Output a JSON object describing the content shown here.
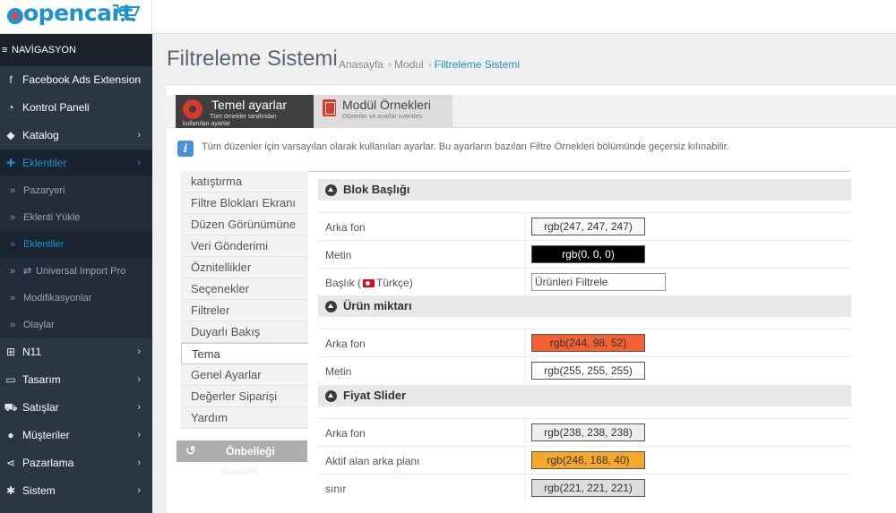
{
  "header": {
    "logo_text": "opencart"
  },
  "sidebar": {
    "nav_title": "NAVİGASYON",
    "items": [
      {
        "label": "Facebook Ads Extension",
        "icon": "facebook-icon",
        "chevron": true
      },
      {
        "label": "Kontrol Paneli",
        "icon": "dashboard-icon",
        "chevron": false
      },
      {
        "label": "Katalog",
        "icon": "tag-icon",
        "chevron": true
      },
      {
        "label": "Eklentiler",
        "icon": "puzzle-icon",
        "chevron": true,
        "active": true
      }
    ],
    "subitems": [
      {
        "label": "Pazaryeri"
      },
      {
        "label": "Eklenti Yükle"
      },
      {
        "label": "Eklentiler",
        "active": true
      },
      {
        "label": "Universal Import Pro",
        "icon": "sync-icon"
      },
      {
        "label": "Modifikasyonlar"
      },
      {
        "label": "Olaylar"
      }
    ],
    "items2": [
      {
        "label": "N11",
        "icon": "sitemap-icon"
      },
      {
        "label": "Tasarım",
        "icon": "monitor-icon"
      },
      {
        "label": "Satışlar",
        "icon": "cart-icon"
      },
      {
        "label": "Müşteriler",
        "icon": "user-icon"
      },
      {
        "label": "Pazarlama",
        "icon": "share-icon"
      },
      {
        "label": "Sistem",
        "icon": "cog-icon"
      }
    ]
  },
  "page": {
    "title": "Filtreleme Sistemi",
    "breadcrumb": [
      "Anasayfa",
      "Modul",
      "Filtreleme Sistemi"
    ]
  },
  "tabs": {
    "tab1_title": "Temel ayarlar",
    "tab1_sub": "Tüm örnekler tarafından",
    "tab1_sub2": "kullanılan ayarlar",
    "tab2_title": "Modül Örnekleri",
    "tab2_sub": "Düzenler ve ayarlar overides"
  },
  "info": {
    "text": "Tüm düzenler için varsayılan olarak kullanılan ayarlar. Bu ayarların bazıları Filtre Örnekleri bölümünde geçersiz kılınabilir."
  },
  "left_menu": [
    "katıştırma",
    "Filtre Blokları Ekranı",
    "Düzen Görünümüne",
    "Veri Gönderimi",
    "Öznitellikler",
    "Seçenekler",
    "Filtreler",
    "Duyarlı Bakış",
    "Tema",
    "Genel Ayarlar",
    "Değerler Siparişi",
    "Yardım"
  ],
  "cache": {
    "label": "Önbelleği",
    "sub": "Güncelle"
  },
  "sections": {
    "s1": {
      "title": "Blok Başlığı",
      "r1_label": "Arka fon",
      "r1_value": "rgb(247, 247, 247)",
      "r1_bg": "#f7f7f7",
      "r1_fg": "#333333",
      "r2_label": "Metin",
      "r2_value": "rgb(0, 0, 0)",
      "r2_bg": "#000000",
      "r2_fg": "#ffffff",
      "r3_label_a": "Başlık (",
      "r3_label_b": "Türkçe)",
      "r3_value": "Ürünleri Filtrele"
    },
    "s2": {
      "title": "Ürün miktarı",
      "r1_label": "Arka fon",
      "r1_value": "rgb(244, 98, 52)",
      "r1_bg": "#f46234",
      "r1_fg": "#333333",
      "r2_label": "Metin",
      "r2_value": "rgb(255, 255, 255)",
      "r2_bg": "#ffffff",
      "r2_fg": "#333333"
    },
    "s3": {
      "title": "Fiyat Slider",
      "r1_label": "Arka fon",
      "r1_value": "rgb(238, 238, 238)",
      "r1_bg": "#eeeeee",
      "r1_fg": "#333333",
      "r2_label": "Aktif alan arka planı",
      "r2_value": "rgb(246, 168, 40)",
      "r2_bg": "#f6a828",
      "r2_fg": "#333333",
      "r3_label": "sınır",
      "r3_value": "rgb(221, 221, 221)",
      "r3_bg": "#dddddd",
      "r3_fg": "#333333"
    }
  }
}
